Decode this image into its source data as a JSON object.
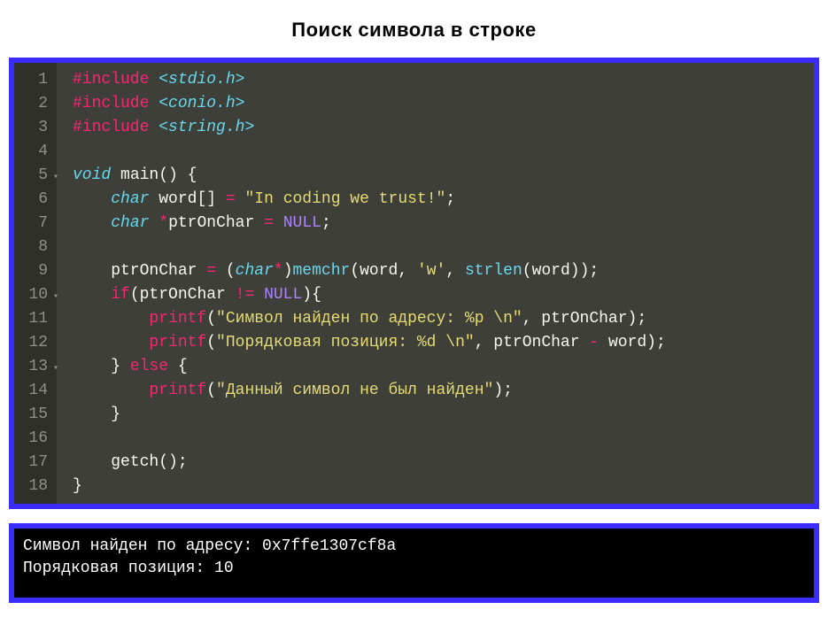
{
  "title": "Поиск символа в строке",
  "code": {
    "lines": [
      {
        "n": "1",
        "fold": false,
        "tokens": [
          [
            "kw-inc",
            "#include"
          ],
          [
            "plain",
            " "
          ],
          [
            "hdr",
            "<stdio.h>"
          ]
        ]
      },
      {
        "n": "2",
        "fold": false,
        "tokens": [
          [
            "kw-inc",
            "#include"
          ],
          [
            "plain",
            " "
          ],
          [
            "hdr",
            "<conio.h>"
          ]
        ]
      },
      {
        "n": "3",
        "fold": false,
        "tokens": [
          [
            "kw-inc",
            "#include"
          ],
          [
            "plain",
            " "
          ],
          [
            "hdr",
            "<string.h>"
          ]
        ]
      },
      {
        "n": "4",
        "fold": false,
        "tokens": []
      },
      {
        "n": "5",
        "fold": true,
        "tokens": [
          [
            "kw-type",
            "void"
          ],
          [
            "plain",
            " main() {"
          ]
        ]
      },
      {
        "n": "6",
        "fold": false,
        "tokens": [
          [
            "plain",
            "    "
          ],
          [
            "kw-type",
            "char"
          ],
          [
            "plain",
            " word[] "
          ],
          [
            "kw-flow",
            "="
          ],
          [
            "plain",
            " "
          ],
          [
            "str",
            "\"In coding we trust!\""
          ],
          [
            "plain",
            ";"
          ]
        ]
      },
      {
        "n": "7",
        "fold": false,
        "tokens": [
          [
            "plain",
            "    "
          ],
          [
            "kw-type",
            "char"
          ],
          [
            "plain",
            " "
          ],
          [
            "kw-flow",
            "*"
          ],
          [
            "plain",
            "ptrOnChar "
          ],
          [
            "kw-flow",
            "="
          ],
          [
            "plain",
            " "
          ],
          [
            "const",
            "NULL"
          ],
          [
            "plain",
            ";"
          ]
        ]
      },
      {
        "n": "8",
        "fold": false,
        "tokens": []
      },
      {
        "n": "9",
        "fold": false,
        "tokens": [
          [
            "plain",
            "    ptrOnChar "
          ],
          [
            "kw-flow",
            "="
          ],
          [
            "plain",
            " ("
          ],
          [
            "kw-type",
            "char"
          ],
          [
            "kw-flow",
            "*"
          ],
          [
            "plain",
            ")"
          ],
          [
            "fn",
            "memchr"
          ],
          [
            "plain",
            "(word, "
          ],
          [
            "chr",
            "'w'"
          ],
          [
            "plain",
            ", "
          ],
          [
            "fn",
            "strlen"
          ],
          [
            "plain",
            "(word));"
          ]
        ]
      },
      {
        "n": "10",
        "fold": true,
        "tokens": [
          [
            "plain",
            "    "
          ],
          [
            "kw-flow",
            "if"
          ],
          [
            "plain",
            "(ptrOnChar "
          ],
          [
            "kw-flow",
            "!="
          ],
          [
            "plain",
            " "
          ],
          [
            "const",
            "NULL"
          ],
          [
            "plain",
            "){"
          ]
        ]
      },
      {
        "n": "11",
        "fold": false,
        "tokens": [
          [
            "plain",
            "        "
          ],
          [
            "fn-red",
            "printf"
          ],
          [
            "plain",
            "("
          ],
          [
            "str",
            "\"Символ найден по адресу: %p \\n\""
          ],
          [
            "plain",
            ", ptrOnChar);"
          ]
        ]
      },
      {
        "n": "12",
        "fold": false,
        "tokens": [
          [
            "plain",
            "        "
          ],
          [
            "fn-red",
            "printf"
          ],
          [
            "plain",
            "("
          ],
          [
            "str",
            "\"Порядковая позиция: %d \\n\""
          ],
          [
            "plain",
            ", ptrOnChar "
          ],
          [
            "kw-flow",
            "-"
          ],
          [
            "plain",
            " word);"
          ]
        ]
      },
      {
        "n": "13",
        "fold": true,
        "tokens": [
          [
            "plain",
            "    } "
          ],
          [
            "kw-flow",
            "else"
          ],
          [
            "plain",
            " {"
          ]
        ]
      },
      {
        "n": "14",
        "fold": false,
        "tokens": [
          [
            "plain",
            "        "
          ],
          [
            "fn-red",
            "printf"
          ],
          [
            "plain",
            "("
          ],
          [
            "str",
            "\"Данный символ не был найден\""
          ],
          [
            "plain",
            ");"
          ]
        ]
      },
      {
        "n": "15",
        "fold": false,
        "tokens": [
          [
            "plain",
            "    }"
          ]
        ]
      },
      {
        "n": "16",
        "fold": false,
        "tokens": []
      },
      {
        "n": "17",
        "fold": false,
        "tokens": [
          [
            "plain",
            "    getch();"
          ]
        ]
      },
      {
        "n": "18",
        "fold": false,
        "tokens": [
          [
            "plain",
            "}"
          ]
        ]
      }
    ]
  },
  "console": {
    "lines": [
      "Символ найден по адресу: 0x7ffe1307cf8a",
      "Порядковая позиция: 10"
    ]
  }
}
